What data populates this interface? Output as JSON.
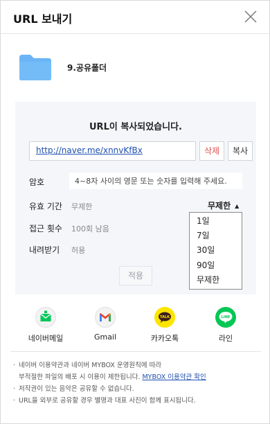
{
  "header": {
    "title": "URL 보내기"
  },
  "folder": {
    "name": "9.공유폴더",
    "color": "#6ab4f5"
  },
  "panel": {
    "copied_message": "URL이 복사되었습니다.",
    "url": "http://naver.me/xnnvKfBx",
    "delete_label": "삭제",
    "copy_label": "복사",
    "password": {
      "label": "암호",
      "placeholder": "4~8자 사이의 영문 또는 숫자를 입력해 주세요."
    },
    "validity": {
      "label": "유효 기간",
      "value": "무제한",
      "selected": "무제한"
    },
    "access": {
      "label": "접근 횟수",
      "value": "100회 남음"
    },
    "download": {
      "label": "내려받기",
      "value": "허용"
    },
    "apply_label": "적용"
  },
  "dropdown": {
    "options": [
      "1일",
      "7일",
      "30일",
      "90일",
      "무제한"
    ]
  },
  "share": [
    {
      "label": "네이버메일",
      "icon": "naver-mail-icon"
    },
    {
      "label": "Gmail",
      "icon": "gmail-icon"
    },
    {
      "label": "카카오톡",
      "icon": "kakaotalk-icon"
    },
    {
      "label": "라인",
      "icon": "line-icon"
    }
  ],
  "notes": {
    "line1": "네이버 이용약관과 네이버 MYBOX 운영원칙에 따라",
    "line1b": "부적절한 파일의 배포 시 이용이 제한됩니다.",
    "link": "MYBOX 이용약관 확인",
    "line2": "저작권이 있는 음악은 공유할 수 없습니다.",
    "line3": "URL을 외부로 공유할 경우 별명과 대표 사진이 함께 표시됩니다."
  },
  "colors": {
    "accent": "#1d4fb0",
    "delete": "#d9534f",
    "panel": "#f4f6f9"
  }
}
